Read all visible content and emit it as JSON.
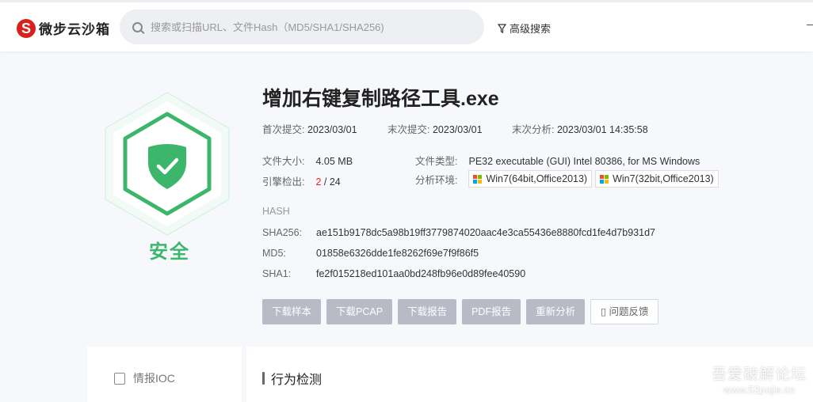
{
  "header": {
    "logo_text": "微步云沙箱",
    "logo_mark": "S",
    "search_placeholder": "搜索或扫描URL、文件Hash（MD5/SHA1/SHA256)",
    "advanced_search": "高级搜索"
  },
  "verdict": {
    "label": "安全",
    "color": "#3cb66b"
  },
  "file": {
    "name": "增加右键复制路径工具.exe",
    "first_submit_label": "首次提交:",
    "first_submit": "2023/03/01",
    "last_submit_label": "末次提交:",
    "last_submit": "2023/03/01",
    "last_analysis_label": "末次分析:",
    "last_analysis": "2023/03/01 14:35:58",
    "size_label": "文件大小:",
    "size": "4.05 MB",
    "type_label": "文件类型:",
    "type": "PE32 executable (GUI) Intel 80386, for MS Windows",
    "engines_label": "引擎检出:",
    "engines_detected": "2",
    "engines_sep": " / ",
    "engines_total": "24",
    "env_label": "分析环境:",
    "envs": [
      "Win7(64bit,Office2013)",
      "Win7(32bit,Office2013)"
    ]
  },
  "hash": {
    "heading": "HASH",
    "sha256_label": "SHA256:",
    "sha256": "ae151b9178dc5a98b19ff3779874020aac4e3ca55436e8880fcd1fe4d7b931d7",
    "md5_label": "MD5:",
    "md5": "01858e6326dde1fe8262f69e7f9f86f5",
    "sha1_label": "SHA1:",
    "sha1": "fe2f015218ed101aa0bd248fb96e0d89fee40590"
  },
  "actions": [
    "下载样本",
    "下载PCAP",
    "下载报告",
    "PDF报告",
    "重新分析",
    "问题反馈"
  ],
  "sidebar": {
    "item": "情报IOC"
  },
  "section": {
    "title": "行为检测"
  },
  "watermark": {
    "line1": "吾爱破解论坛",
    "line2": "www.52pojie.cn"
  }
}
